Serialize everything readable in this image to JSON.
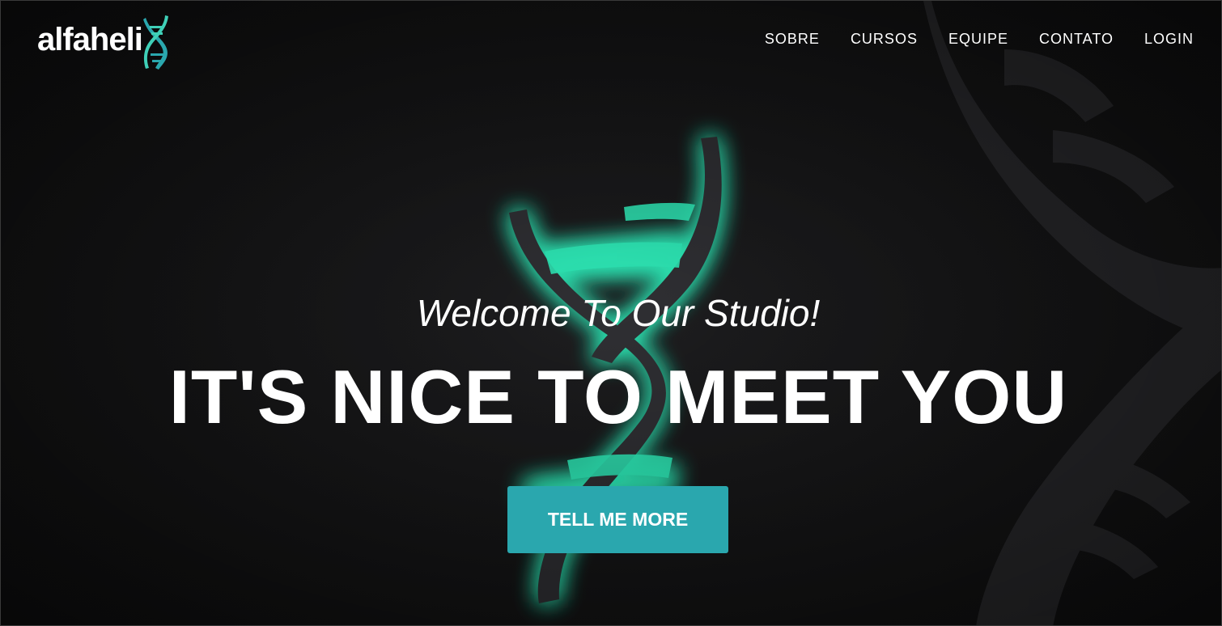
{
  "brand": {
    "name": "alfaheli",
    "logo_icon": "dna-helix-x-icon"
  },
  "nav": {
    "items": [
      {
        "label": "SOBRE"
      },
      {
        "label": "CURSOS"
      },
      {
        "label": "EQUIPE"
      },
      {
        "label": "CONTATO"
      },
      {
        "label": "LOGIN"
      }
    ]
  },
  "hero": {
    "subheading": "Welcome To Our Studio!",
    "heading": "IT'S NICE TO MEET YOU",
    "cta_label": "TELL ME MORE",
    "background_icon": "dna-helix-icon"
  },
  "colors": {
    "background": "#151516",
    "accent": "#2aa7ae",
    "glow": "#2ee8b6",
    "text": "#ffffff"
  }
}
